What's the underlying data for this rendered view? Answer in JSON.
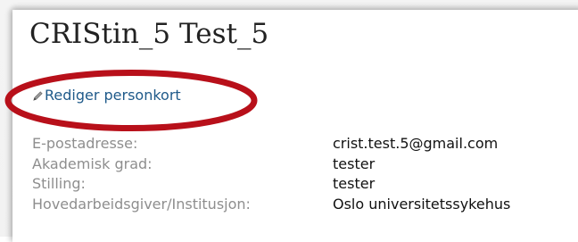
{
  "person": {
    "name": "CRIStin_5 Test_5",
    "edit_link_label": "Rediger personkort"
  },
  "icons": {
    "edit": "pencil-icon"
  },
  "colors": {
    "link": "#1f5a8a",
    "label": "#8e8e8e",
    "highlight": "#b8101a"
  },
  "details": [
    {
      "label": "E-postadresse:",
      "value": "crist.test.5@gmail.com"
    },
    {
      "label": "Akademisk grad:",
      "value": "tester"
    },
    {
      "label": "Stilling:",
      "value": "tester"
    },
    {
      "label": "Hovedarbeidsgiver/Institusjon:",
      "value": "Oslo universitetssykehus"
    }
  ]
}
